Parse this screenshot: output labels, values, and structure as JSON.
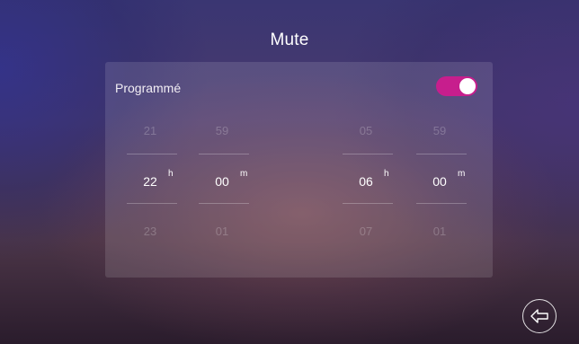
{
  "header": {
    "title": "Mute"
  },
  "schedule": {
    "label": "Programmé",
    "enabled": true,
    "toggle_color": "#c71e8d",
    "start": {
      "hour": {
        "prev": "21",
        "current": "22",
        "next": "23",
        "unit": "h"
      },
      "minute": {
        "prev": "59",
        "current": "00",
        "next": "01",
        "unit": "m"
      }
    },
    "end": {
      "hour": {
        "prev": "05",
        "current": "06",
        "next": "07",
        "unit": "h"
      },
      "minute": {
        "prev": "59",
        "current": "00",
        "next": "01",
        "unit": "m"
      }
    }
  },
  "icons": {
    "back": "back-arrow-icon"
  }
}
